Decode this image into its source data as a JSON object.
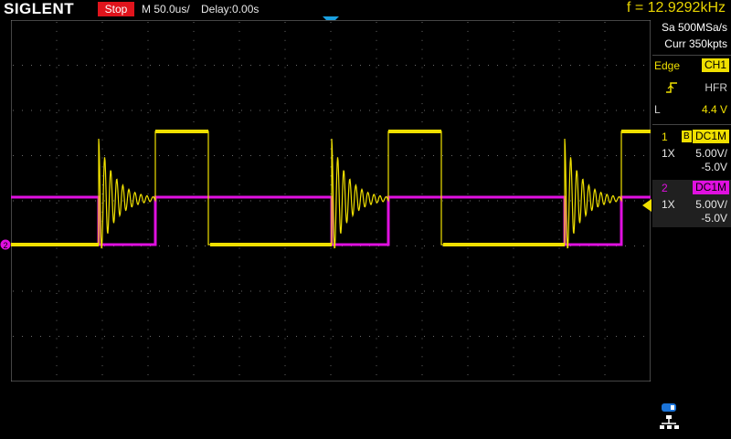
{
  "header": {
    "brand": "SIGLENT",
    "run_state": "Stop",
    "timebase": "M 50.0us/",
    "delay": "Delay:0.00s",
    "frequency": "f = 12.9292kHz"
  },
  "acquisition": {
    "sample_rate": "Sa 500MSa/s",
    "memory_depth": "Curr 350kpts"
  },
  "trigger": {
    "type": "Edge",
    "source": "CH1",
    "coupling": "HFR",
    "level_prefix": "L",
    "level": "4.4 V"
  },
  "channels": [
    {
      "num": "1",
      "bw_flag": "B",
      "coupling": "DC1M",
      "probe": "1X",
      "scale": "5.00V/",
      "offset": "-5.0V",
      "color": "#f0e000"
    },
    {
      "num": "2",
      "coupling": "DC1M",
      "probe": "1X",
      "scale": "5.00V/",
      "offset": "-5.0V",
      "color": "#e010e0"
    }
  ],
  "markers": {
    "ch2_ground": "2"
  },
  "colors": {
    "ch1": "#f0e000",
    "ch2": "#e010e0",
    "grid": "#6a6a6a",
    "trigger_pos": "#1aa0e0"
  }
}
